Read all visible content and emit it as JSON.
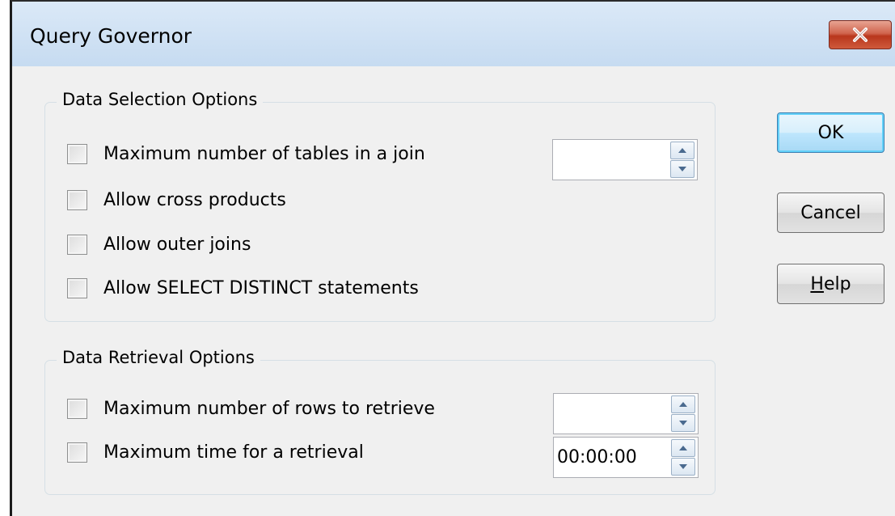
{
  "window": {
    "title": "Query Governor"
  },
  "data_selection": {
    "legend": "Data Selection Options",
    "options": [
      {
        "label": "Maximum number of tables in a join",
        "checked": false
      },
      {
        "label": "Allow cross products",
        "checked": false
      },
      {
        "label": "Allow outer joins",
        "checked": false
      },
      {
        "label": "Allow SELECT DISTINCT statements",
        "checked": false
      }
    ],
    "max_tables_value": ""
  },
  "data_retrieval": {
    "legend": "Data Retrieval Options",
    "options": [
      {
        "label": "Maximum number of rows to retrieve",
        "checked": false
      },
      {
        "label": "Maximum time for a retrieval",
        "checked": false
      }
    ],
    "max_rows_value": "",
    "max_time_value": "00:00:00"
  },
  "buttons": {
    "ok_label": "OK",
    "cancel_label": "Cancel",
    "help_label_mnemonic": "H",
    "help_label_rest": "elp"
  },
  "icons": {
    "close": "close-icon",
    "spin_up": "arrow-up-icon",
    "spin_down": "arrow-down-icon"
  },
  "colors": {
    "titlebar": "#c6dbf1",
    "close_button": "#c7492d",
    "default_button": "#bee6fd",
    "dialog_background": "#f0f0f0"
  }
}
